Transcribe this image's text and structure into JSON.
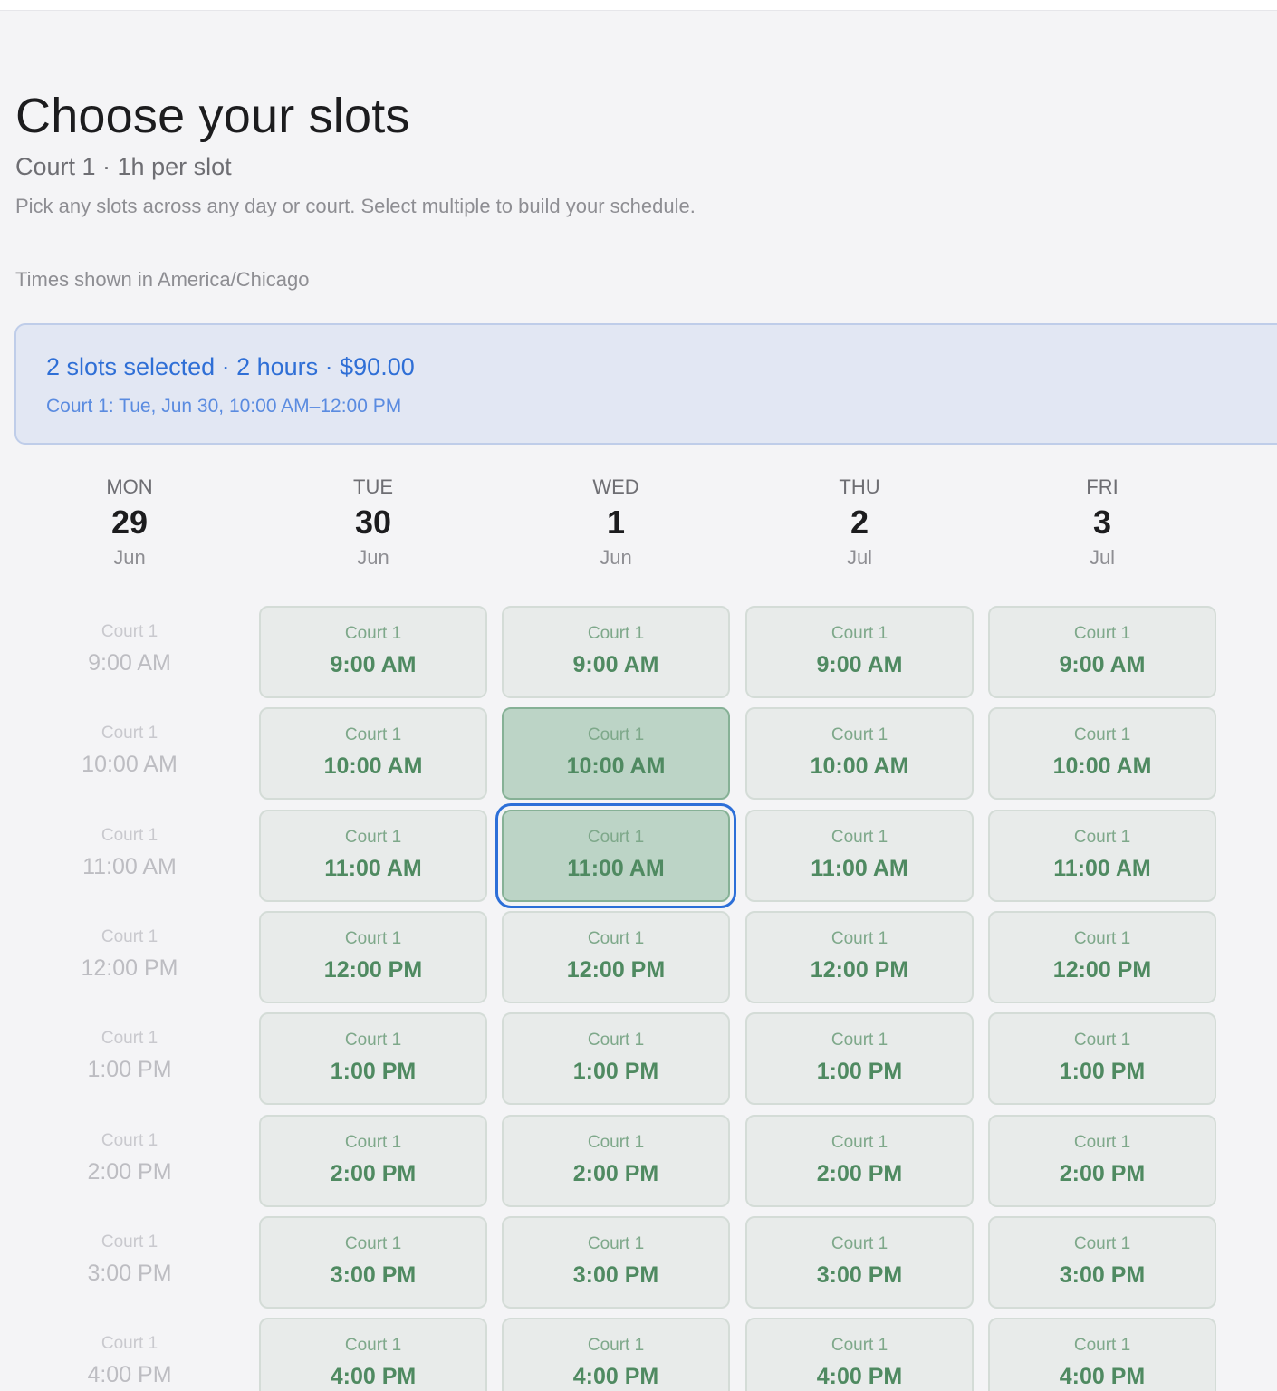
{
  "header": {
    "title": "Choose your slots",
    "subtitle": "Court 1 · 1h per slot",
    "helper": "Pick any slots across any day or court. Select multiple to build your schedule.",
    "timezone": "Times shown in America/Chicago"
  },
  "summary": {
    "title": "2 slots selected · 2 hours · $90.00",
    "detail": "Court 1: Tue, Jun 30, 10:00 AM–12:00 PM"
  },
  "days": [
    {
      "dow": "MON",
      "num": "29",
      "month": "Jun"
    },
    {
      "dow": "TUE",
      "num": "30",
      "month": "Jun"
    },
    {
      "dow": "WED",
      "num": "1",
      "month": "Jun"
    },
    {
      "dow": "THU",
      "num": "2",
      "month": "Jul"
    },
    {
      "dow": "FRI",
      "num": "3",
      "month": "Jul"
    }
  ],
  "court_label": "Court 1",
  "times": [
    "9:00 AM",
    "10:00 AM",
    "11:00 AM",
    "12:00 PM",
    "1:00 PM",
    "2:00 PM",
    "3:00 PM",
    "4:00 PM"
  ],
  "slot_states": [
    [
      "past",
      "available",
      "available",
      "available",
      "available"
    ],
    [
      "past",
      "available",
      "selected",
      "available",
      "available"
    ],
    [
      "past",
      "available",
      "focused",
      "available",
      "available"
    ],
    [
      "past",
      "available",
      "available",
      "available",
      "available"
    ],
    [
      "past",
      "available",
      "available",
      "available",
      "available"
    ],
    [
      "past",
      "available",
      "available",
      "available",
      "available"
    ],
    [
      "past",
      "available",
      "available",
      "available",
      "available"
    ],
    [
      "past",
      "available",
      "available",
      "available",
      "available"
    ]
  ]
}
